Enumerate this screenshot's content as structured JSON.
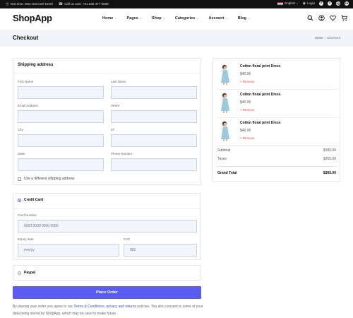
{
  "topbar": {
    "visit": "Visit time: Mon-Sat 8:00-18:00",
    "call": "Call us now: +01 535-477-5568",
    "language": "English",
    "login": "Login",
    "social": [
      "f",
      "t",
      "ig",
      "in"
    ]
  },
  "navbar": {
    "logo": "ShopApp",
    "menu": [
      "Home",
      "Pages",
      "Shop",
      "Categories",
      "Account",
      "Blog"
    ],
    "icons": [
      "search-icon",
      "user-icon",
      "heart-icon",
      "cart-icon"
    ]
  },
  "page": {
    "title": "Checkout",
    "breadcrumb": {
      "home": "Home",
      "sep": "/",
      "current": "Checkout"
    }
  },
  "shipping": {
    "title": "Shipping address",
    "fields": {
      "first_name": {
        "label": "First Name",
        "value": ""
      },
      "last_name": {
        "label": "Last Name",
        "value": ""
      },
      "email": {
        "label": "Email Address",
        "value": ""
      },
      "street": {
        "label": "Street",
        "value": ""
      },
      "city": {
        "label": "City",
        "value": ""
      },
      "zip": {
        "label": "Zi*",
        "value": ""
      },
      "state": {
        "label": "State",
        "value": ""
      },
      "phone": {
        "label": "Phone Number",
        "value": ""
      }
    },
    "different_address": "Use a different shipping address"
  },
  "payment": {
    "credit_card": {
      "label": "Credit Card",
      "selected": true,
      "card_number_label": "Card Number",
      "card_number_placeholder": "0000 0000 0000 0000",
      "expiry_label": "Expiry date",
      "expiry_placeholder": "mm/yy",
      "cvc_label": "CVC",
      "cvc_placeholder": "000"
    },
    "paypal": {
      "label": "Paypal",
      "selected": false
    }
  },
  "actions": {
    "place_order": "Place Order"
  },
  "policy": {
    "before": "By placing your order you agree to our ",
    "link1": "Terms & Conditions",
    "mid": ", ",
    "link2": "privacy and returns",
    "after": " policies. You also consent to some of your data being stored by ShopApp, which may be used to make future"
  },
  "order": {
    "items": [
      {
        "name": "Cotton floral print Dress",
        "price": "$40.00",
        "remove": "× Remove"
      },
      {
        "name": "Cotton floral print Dress",
        "price": "$40.00",
        "remove": "× Remove"
      },
      {
        "name": "Cotton floral print Dress",
        "price": "$40.00",
        "remove": "× Remove"
      }
    ],
    "subtotal_label": "Subtotal",
    "subtotal": "$265.00",
    "taxes_label": "Taxes",
    "taxes": "$265.00",
    "grand_total_label": "Grand Total",
    "grand_total": "$265.00"
  },
  "colors": {
    "accent": "#5a5cf0",
    "remove": "#ee4444",
    "link": "#3a4bd1",
    "topbar": "#111111"
  }
}
